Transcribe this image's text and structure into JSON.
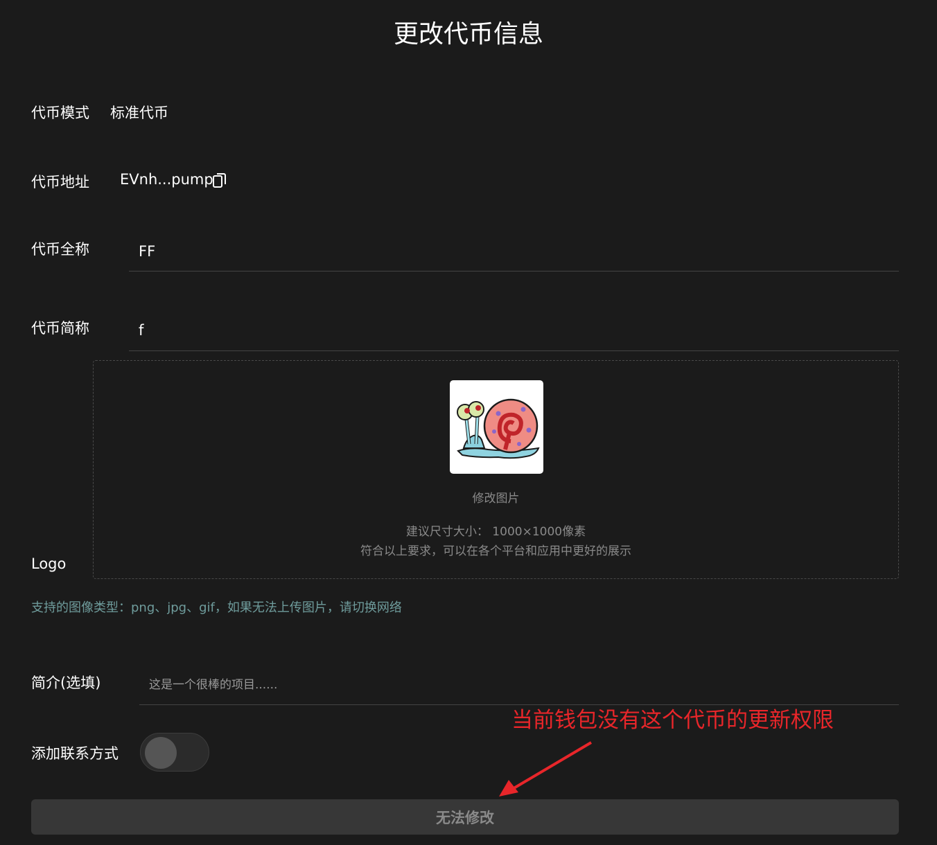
{
  "page": {
    "title": "更改代币信息"
  },
  "form": {
    "mode": {
      "label": "代币模式",
      "value": "标准代币"
    },
    "address": {
      "label": "代币地址",
      "value": "EVnh...pump"
    },
    "full_name": {
      "label": "代币全称",
      "value": "FF"
    },
    "short_name": {
      "label": "代币简称",
      "value": "f"
    },
    "logo": {
      "label": "Logo",
      "change_text": "修改图片",
      "hint_size": "建议尺寸大小： 1000×1000像素",
      "hint_platform": "符合以上要求，可以在各个平台和应用中更好的展示"
    },
    "support_note": "支持的图像类型：png、jpg、gif，如果无法上传图片，请切换网络",
    "intro": {
      "label": "简介(选填)",
      "placeholder": "这是一个很棒的项目......"
    },
    "contact": {
      "label": "添加联系方式",
      "enabled": false
    },
    "submit_label": "无法修改"
  },
  "annotation": {
    "text": "当前钱包没有这个代币的更新权限",
    "color": "#e8262a"
  },
  "icons": {
    "copy": "copy-icon",
    "logo_image": "snail-logo-image"
  }
}
